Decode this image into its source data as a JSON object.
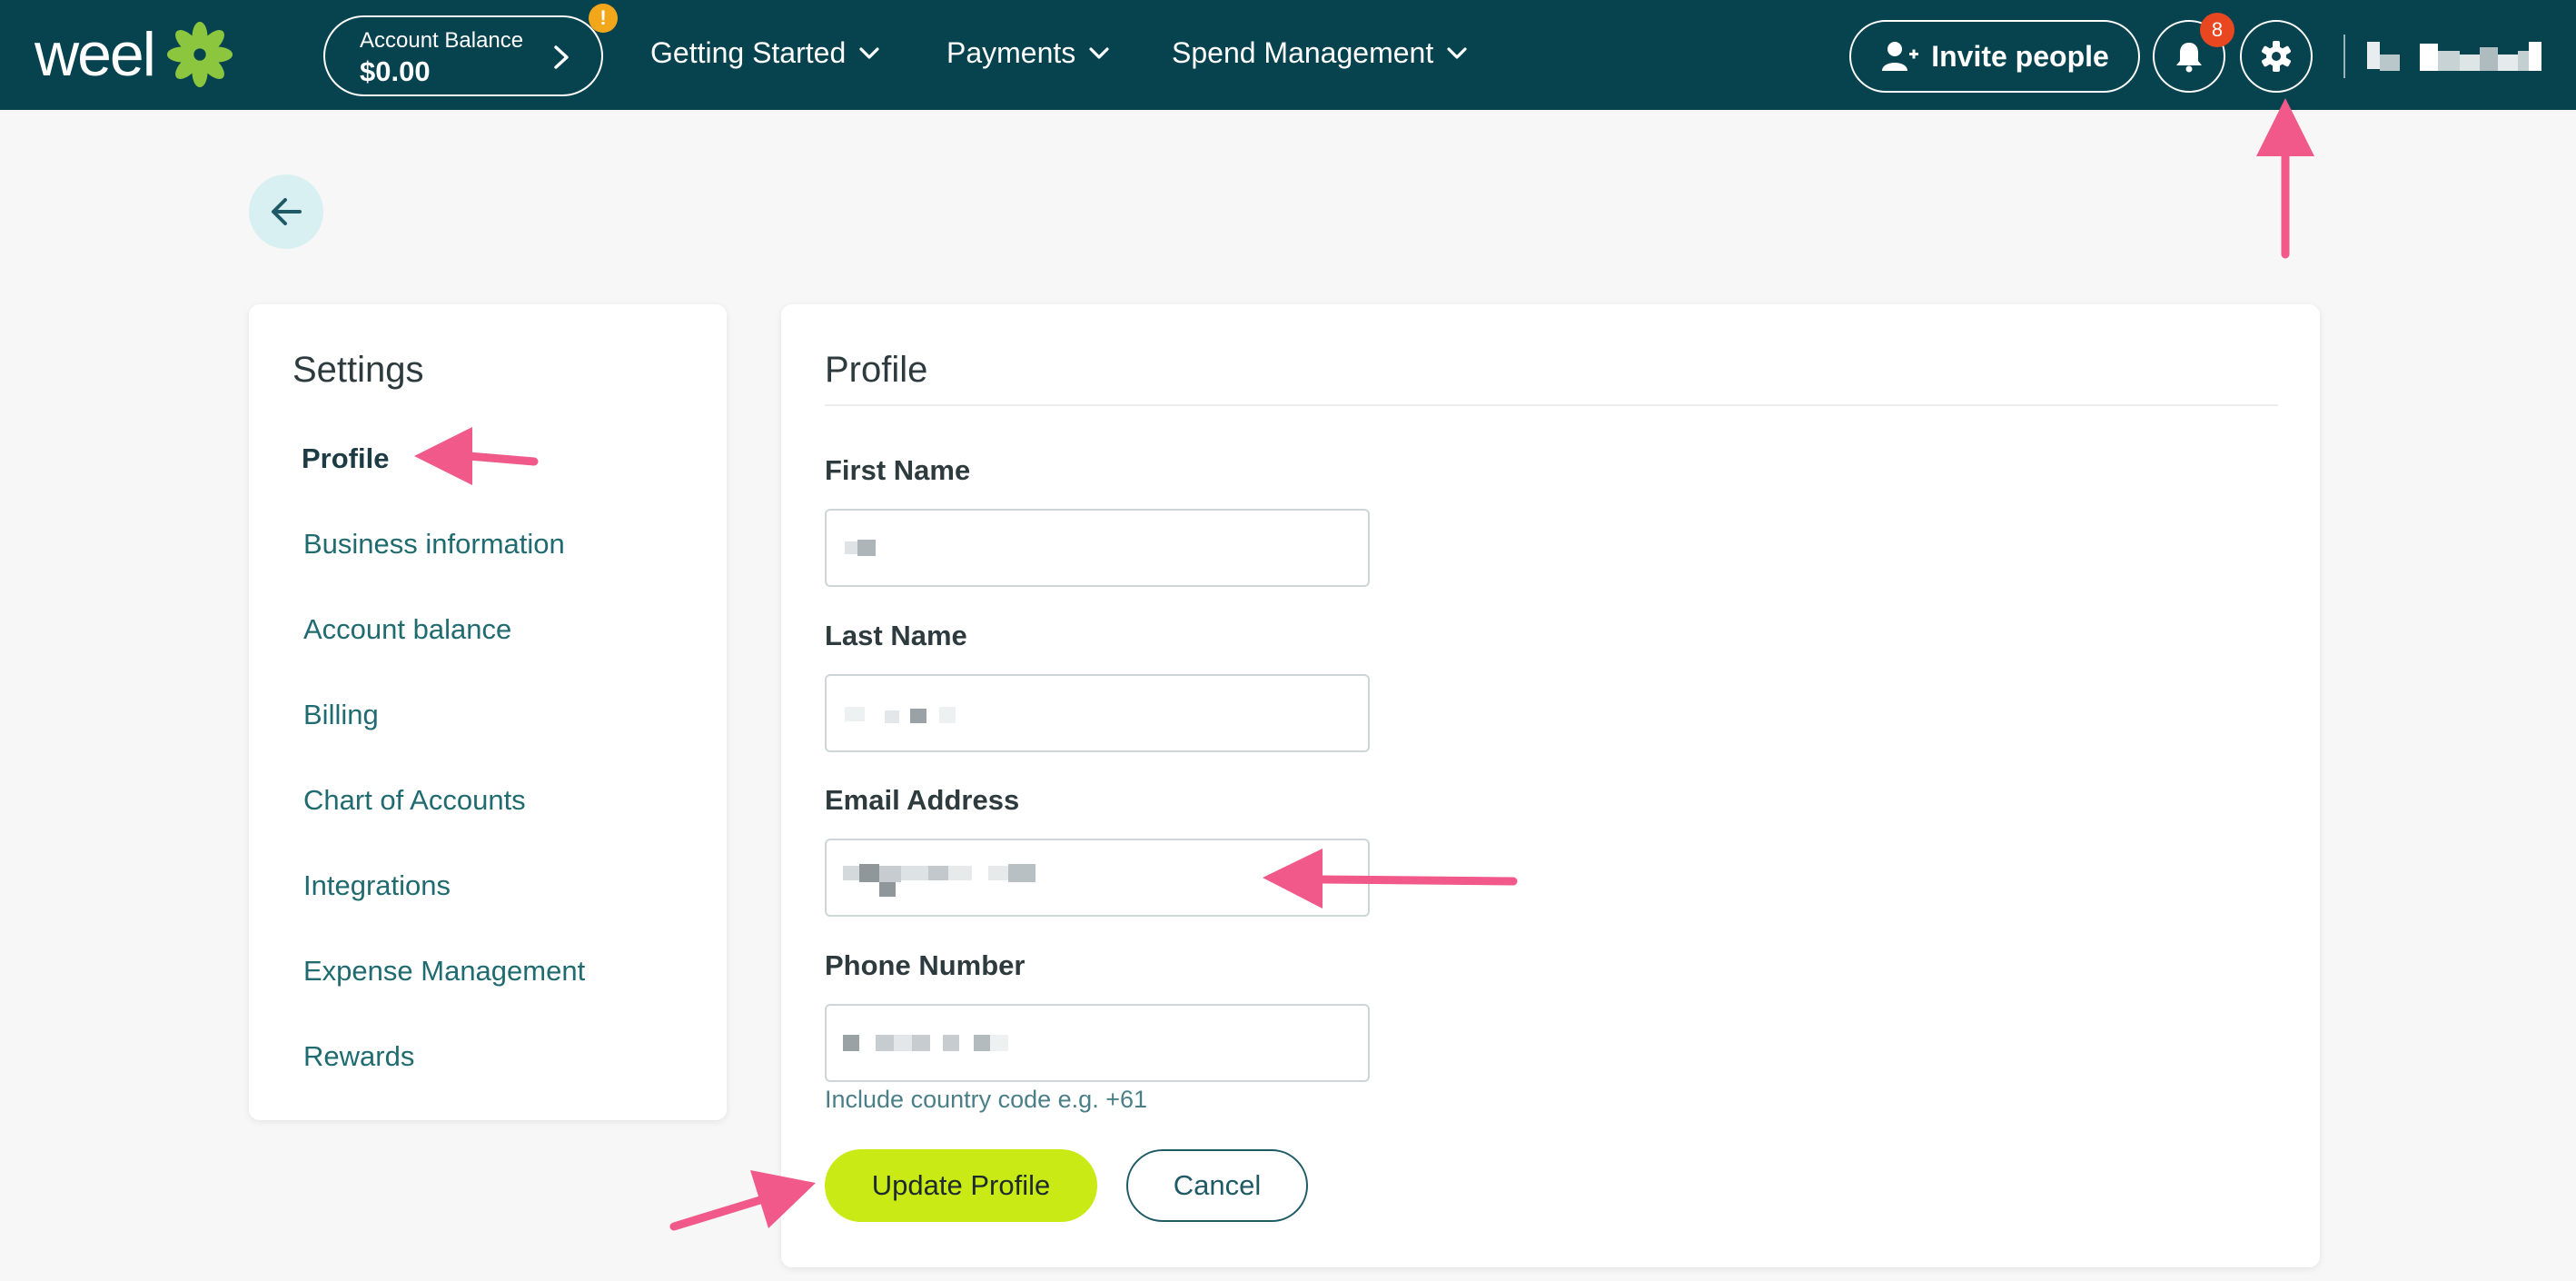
{
  "brand": {
    "logo_text": "weel",
    "accent": "#c9ea14",
    "topbar_color": "#07434f",
    "annotation_color": "#f0598a"
  },
  "header": {
    "balance_label": "Account Balance",
    "balance_value": "$0.00",
    "alert_badge": "!",
    "nav": [
      {
        "label": "Getting Started"
      },
      {
        "label": "Payments"
      },
      {
        "label": "Spend Management"
      }
    ],
    "invite_label": "Invite people",
    "notification_count": "8",
    "icons": [
      "chevron-right-icon",
      "chevron-down-icon",
      "add-user-icon",
      "bell-icon",
      "gear-icon"
    ]
  },
  "sidebar": {
    "title": "Settings",
    "items": [
      {
        "label": "Profile",
        "active": true
      },
      {
        "label": "Business information"
      },
      {
        "label": "Account balance"
      },
      {
        "label": "Billing"
      },
      {
        "label": "Chart of Accounts"
      },
      {
        "label": "Integrations"
      },
      {
        "label": "Expense Management"
      },
      {
        "label": "Rewards"
      }
    ]
  },
  "profile": {
    "title": "Profile",
    "fields": [
      {
        "label": "First Name"
      },
      {
        "label": "Last Name"
      },
      {
        "label": "Email Address"
      },
      {
        "label": "Phone Number"
      }
    ],
    "phone_helper": "Include country code e.g. +61",
    "update_label": "Update Profile",
    "cancel_label": "Cancel"
  }
}
